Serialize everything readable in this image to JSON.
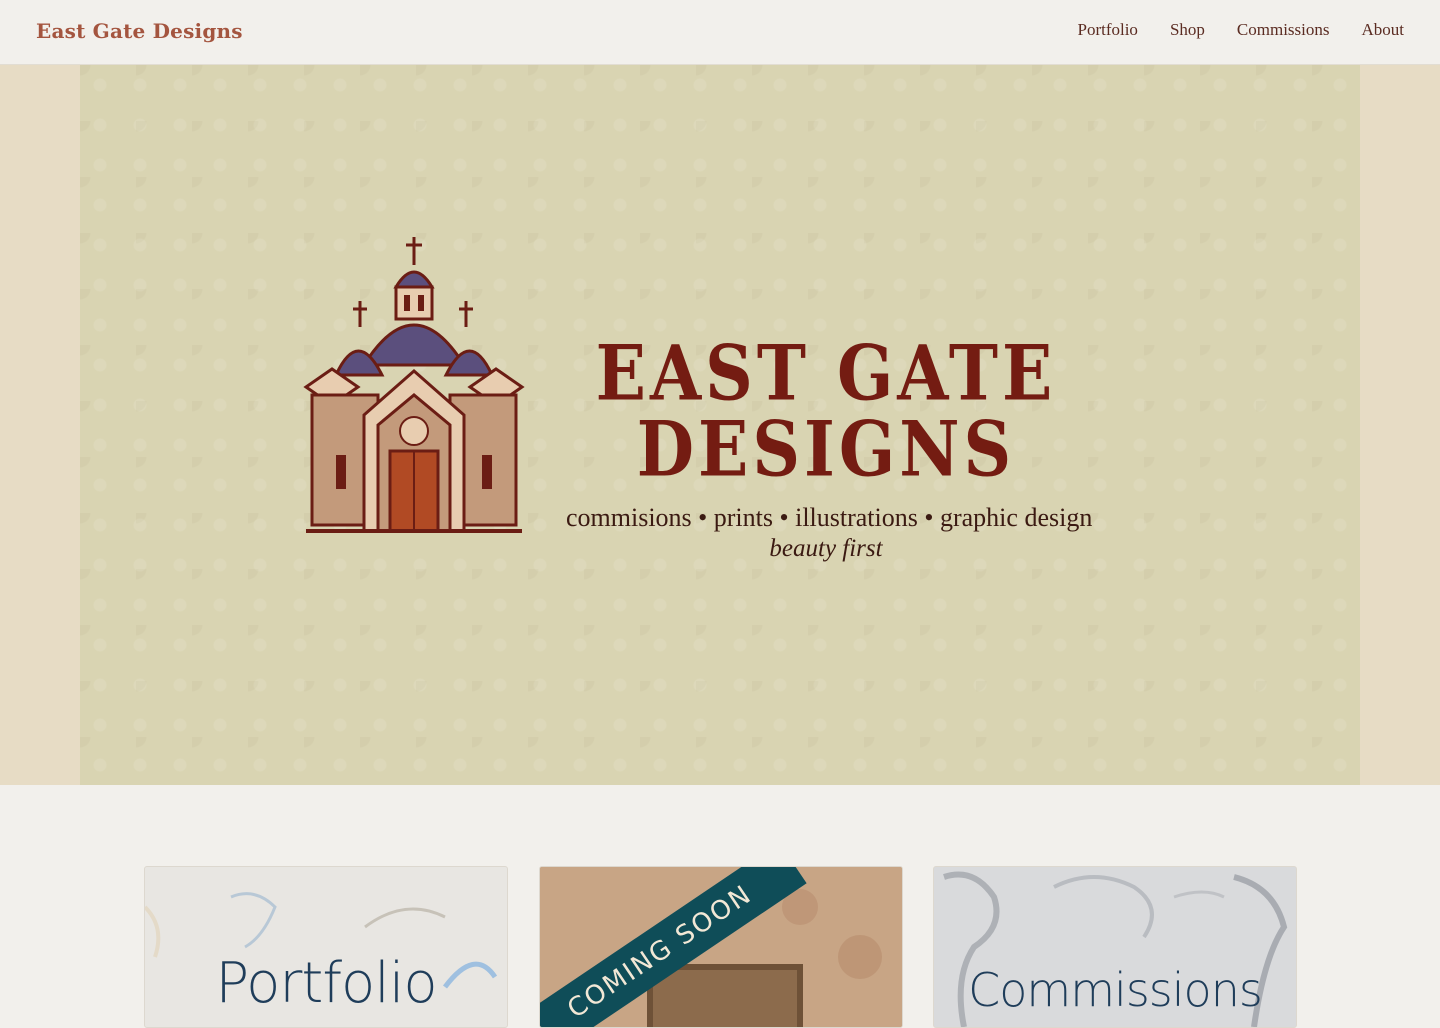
{
  "header": {
    "brand": "East Gate Designs",
    "nav": [
      "Portfolio",
      "Shop",
      "Commissions",
      "About"
    ]
  },
  "hero": {
    "logo_title": "EAST GATE DESIGNS",
    "logo_subtitle": "commisions • prints • illustrations • graphic design",
    "logo_tagline": "beauty first"
  },
  "cards": [
    {
      "title": "Portfolio"
    },
    {
      "ribbon": "COMING SOON"
    },
    {
      "title": "Commissions"
    }
  ],
  "colors": {
    "brand": "#a4553f",
    "logo_red": "#741c12",
    "hero_bg": "#d9d4b2",
    "ribbon": "#0f4d58",
    "card_title": "#1f3d5a"
  }
}
